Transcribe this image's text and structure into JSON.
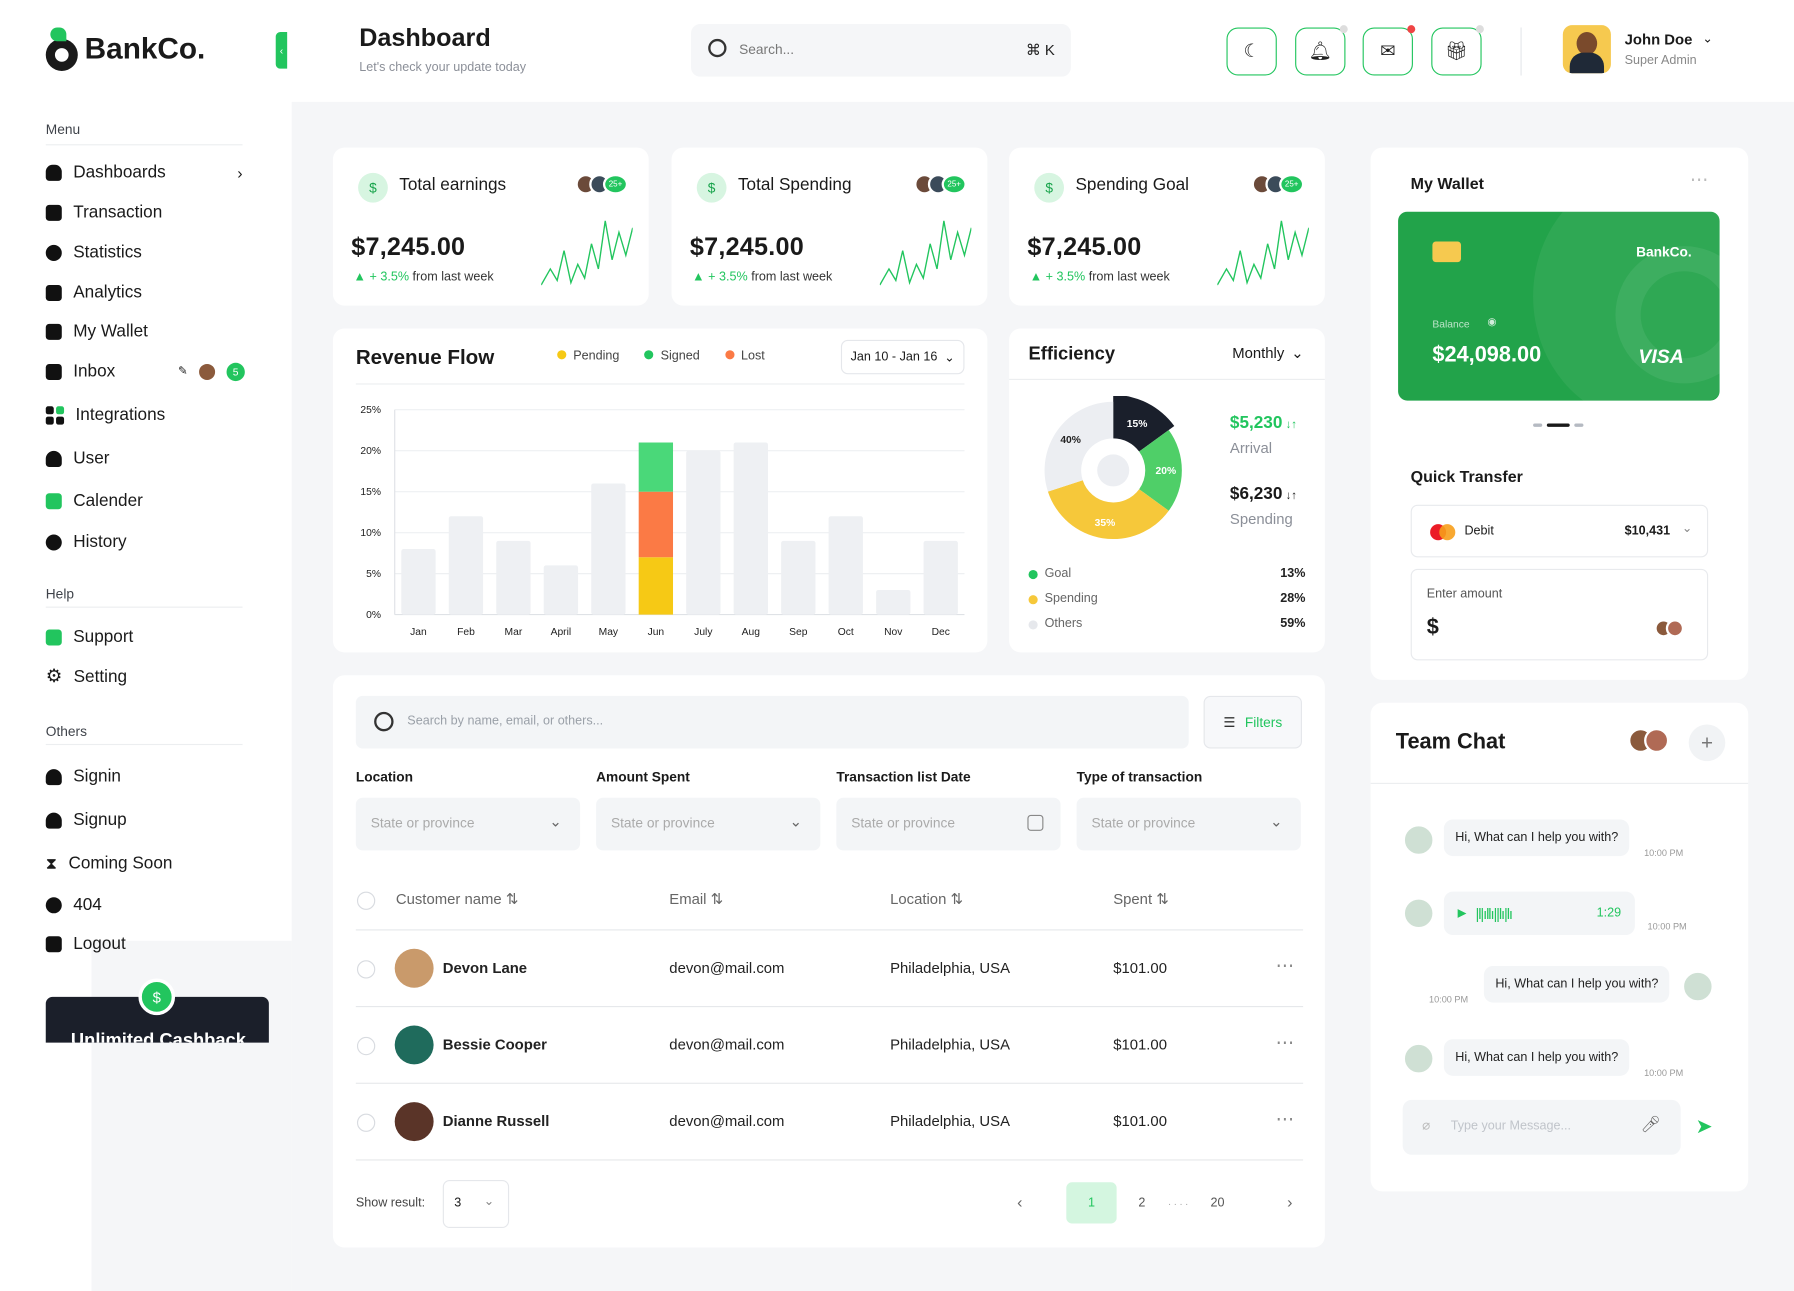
{
  "brand": {
    "name": "BankCo."
  },
  "header": {
    "title": "Dashboard",
    "subtitle": "Let's check your update today",
    "search_placeholder": "Search...",
    "search_shortcut": "⌘ K",
    "user_name": "John Doe",
    "user_role": "Super Admin"
  },
  "sidebar": {
    "menu_label": "Menu",
    "menu_items": [
      "Dashboards",
      "Transaction",
      "Statistics",
      "Analytics",
      "My Wallet",
      "Inbox",
      "Integrations",
      "User",
      "Calender",
      "History"
    ],
    "inbox_badge": "5",
    "help_label": "Help",
    "help_items": [
      "Support",
      "Setting"
    ],
    "others_label": "Others",
    "others_items": [
      "Signin",
      "Signup",
      "Coming Soon",
      "404",
      "Logout"
    ],
    "promo_title": "Unlimited Cashback"
  },
  "stats": [
    {
      "title": "Total earnings",
      "value": "$7,245.00",
      "change": "+ 3.5%",
      "change_suffix": "from last week",
      "badge": "25+"
    },
    {
      "title": "Total Spending",
      "value": "$7,245.00",
      "change": "+ 3.5%",
      "change_suffix": "from last week",
      "badge": "25+"
    },
    {
      "title": "Spending Goal",
      "value": "$7,245.00",
      "change": "+ 3.5%",
      "change_suffix": "from last week",
      "badge": "25+"
    }
  ],
  "revenue": {
    "title": "Revenue Flow",
    "legend": [
      "Pending",
      "Signed",
      "Lost"
    ],
    "range": "Jan 10 - Jan 16"
  },
  "chart_data": {
    "type": "bar",
    "categories": [
      "Jan",
      "Feb",
      "Mar",
      "April",
      "May",
      "Jun",
      "July",
      "Aug",
      "Sep",
      "Oct",
      "Nov",
      "Dec"
    ],
    "values": [
      8,
      12,
      9,
      6,
      16,
      21,
      20,
      21,
      9,
      12,
      3,
      9
    ],
    "stacked_highlight": {
      "category": "Jun",
      "segments": [
        {
          "name": "Pending",
          "value": 7
        },
        {
          "name": "Lost",
          "value": 8
        },
        {
          "name": "Signed",
          "value": 6
        }
      ]
    },
    "yticks": [
      "25%",
      "20%",
      "15%",
      "10%",
      "5%",
      "0%"
    ],
    "ylim": [
      0,
      25
    ],
    "colors": {
      "Pending": "#f6c915",
      "Signed": "#4ad879",
      "Lost": "#fb7a45",
      "base": "#eef0f3"
    }
  },
  "efficiency": {
    "title": "Efficiency",
    "period": "Monthly",
    "arrival_value": "$5,230",
    "arrival_label": "Arrival",
    "spending_value": "$6,230",
    "spending_label": "Spending",
    "donut": [
      {
        "label": "15%",
        "value": 15,
        "color": "#1a1f2b"
      },
      {
        "label": "20%",
        "value": 20,
        "color": "#4fcf68"
      },
      {
        "label": "35%",
        "value": 35,
        "color": "#f6c83a"
      },
      {
        "label": "40%",
        "value": 30,
        "color": "#eceef2"
      }
    ],
    "legend": [
      {
        "name": "Goal",
        "pct": "13%",
        "color": "#22c55e"
      },
      {
        "name": "Spending",
        "pct": "28%",
        "color": "#f6c83a"
      },
      {
        "name": "Others",
        "pct": "59%",
        "color": "#e6e8ec"
      }
    ]
  },
  "table": {
    "search_placeholder": "Search by name, email, or others...",
    "filters_label": "Filters",
    "filters": [
      {
        "label": "Location",
        "placeholder": "State or province"
      },
      {
        "label": "Amount Spent",
        "placeholder": "State or province"
      },
      {
        "label": "Transaction list Date",
        "placeholder": "State or province"
      },
      {
        "label": "Type of transaction",
        "placeholder": "State or province"
      }
    ],
    "columns": [
      "Customer name",
      "Email",
      "Location",
      "Spent"
    ],
    "rows": [
      {
        "name": "Devon Lane",
        "email": "devon@mail.com",
        "location": "Philadelphia, USA",
        "spent": "$101.00"
      },
      {
        "name": "Bessie Cooper",
        "email": "devon@mail.com",
        "location": "Philadelphia, USA",
        "spent": "$101.00"
      },
      {
        "name": "Dianne Russell",
        "email": "devon@mail.com",
        "location": "Philadelphia, USA",
        "spent": "$101.00"
      }
    ],
    "show_result_label": "Show result:",
    "show_result_value": "3",
    "pages": [
      "1",
      "2",
      ". . . .",
      "20"
    ]
  },
  "wallet": {
    "title": "My Wallet",
    "card_brand": "BankCo.",
    "balance_label": "Balance",
    "balance": "$24,098.00",
    "network": "VISA"
  },
  "transfer": {
    "title": "Quick Transfer",
    "card_type": "Debit",
    "card_amount": "$10,431",
    "amount_label": "Enter amount",
    "currency": "$"
  },
  "chat": {
    "title": "Team Chat",
    "messages": [
      {
        "text": "Hi, What can I help you with?",
        "time": "10:00 PM"
      },
      {
        "text": "1:29",
        "time": "10:00 PM"
      },
      {
        "text": "Hi, What can I help you with?",
        "time": "10:00 PM"
      },
      {
        "text": "Hi, What can I help you with?",
        "time": "10:00 PM"
      }
    ],
    "input_placeholder": "Type your Message..."
  }
}
